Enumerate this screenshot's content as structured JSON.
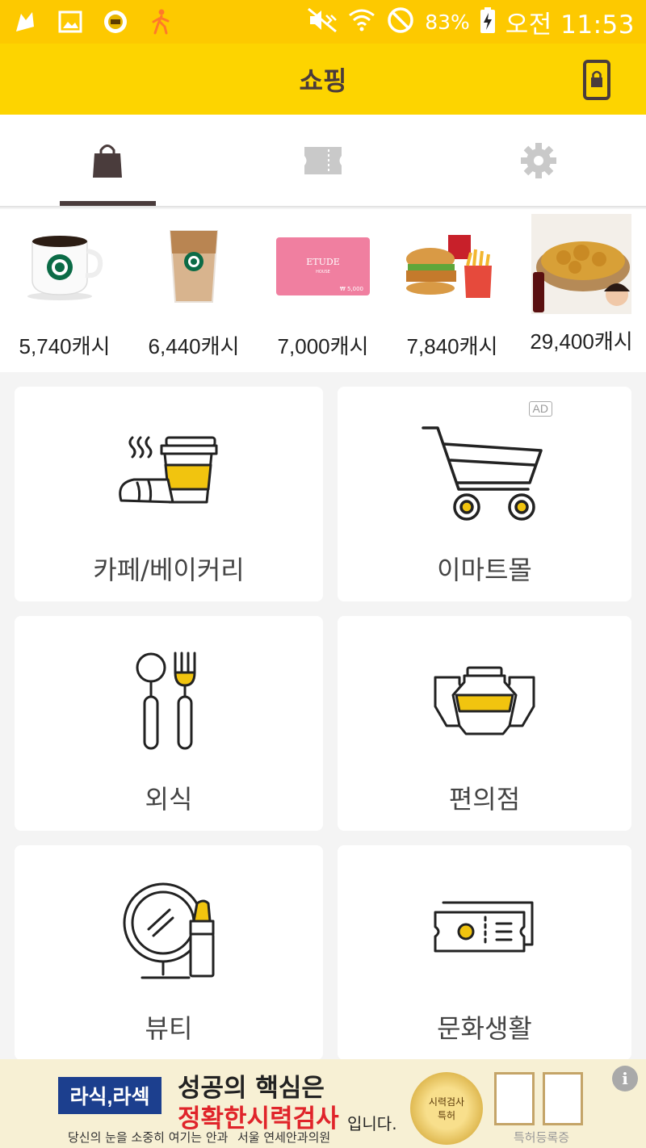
{
  "status_bar": {
    "battery": "83%",
    "time": "오전 11:53"
  },
  "app_bar": {
    "title": "쇼핑"
  },
  "tabs": [
    {
      "icon": "shopping-bag-icon",
      "selected": true
    },
    {
      "icon": "ticket-icon",
      "selected": false
    },
    {
      "icon": "gear-icon",
      "selected": false
    }
  ],
  "products": [
    {
      "price": "5,740캐시"
    },
    {
      "price": "6,440캐시"
    },
    {
      "price": "7,000캐시",
      "card_brand": "ETUDE",
      "card_sub": "HOUSE",
      "card_value": "₩ 5,000"
    },
    {
      "price": "7,840캐시"
    },
    {
      "price": "29,400캐시"
    }
  ],
  "categories": [
    {
      "label": "카페/베이커리"
    },
    {
      "label": "이마트몰",
      "ad": "AD"
    },
    {
      "label": "외식"
    },
    {
      "label": "편의점"
    },
    {
      "label": "뷰티"
    },
    {
      "label": "문화생활"
    }
  ],
  "banner": {
    "logo": "라식,라섹",
    "line1": "성공의 핵심은",
    "line2": "정확한시력검사",
    "line2_suffix": "입니다.",
    "line3": "당신의 눈을 소중히 여기는 안과",
    "clinic": "서울 연세안과의원",
    "medal_text_1": "시력검사",
    "medal_text_2": "특허",
    "patent": "특허등록증",
    "info": "i"
  },
  "colors": {
    "brand_yellow": "#fdd400",
    "accent_yellow": "#f1c40f",
    "dark": "#4a3c3c"
  }
}
